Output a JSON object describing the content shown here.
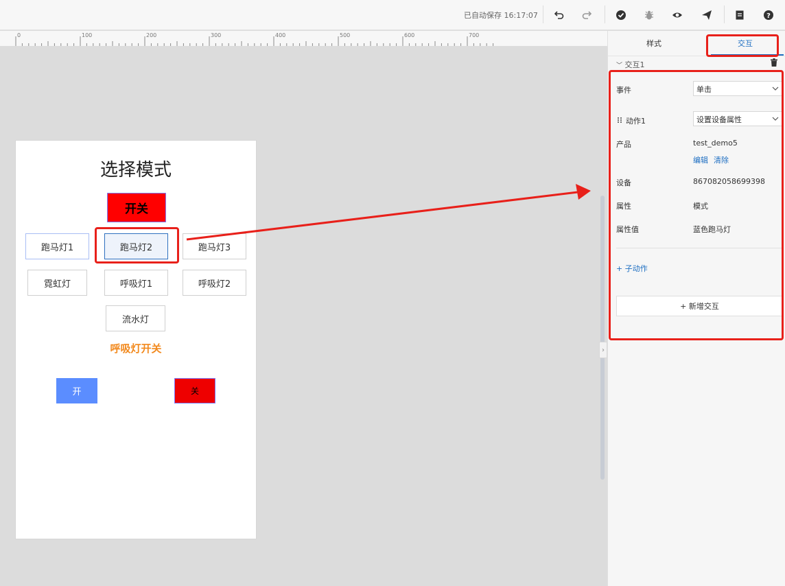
{
  "toolbar": {
    "autosave": "已自动保存 16:17:07",
    "icons": [
      "undo-icon",
      "redo-icon",
      "check-icon",
      "bug-icon",
      "eye-icon",
      "send-icon",
      "document-icon",
      "help-icon"
    ]
  },
  "ruler": {
    "ticks": [
      "0",
      "100",
      "200",
      "300",
      "400",
      "500",
      "600",
      "700"
    ]
  },
  "canvas": {
    "title": "选择模式",
    "switch_label": "开关",
    "mode_buttons": [
      "跑马灯1",
      "跑马灯2",
      "跑马灯3",
      "霓虹灯",
      "呼吸灯1",
      "呼吸灯2",
      "流水灯"
    ],
    "breath_label": "呼吸灯开关",
    "on_label": "开",
    "off_label": "关"
  },
  "panel": {
    "tabs": [
      "样式",
      "交互"
    ],
    "active_tab": "交互",
    "interaction_title": "交互1",
    "event_label": "事件",
    "event_value": "单击",
    "action_label": "动作1",
    "action_value": "设置设备属性",
    "product_label": "产品",
    "product_value": "test_demo5",
    "edit_label": "编辑",
    "clear_label": "清除",
    "device_label": "设备",
    "device_value": "867082058699398",
    "property_label": "属性",
    "property_value": "模式",
    "property_value_label": "属性值",
    "property_value_value": "蓝色跑马灯",
    "sub_action_label": "+ 子动作",
    "add_interaction_label": "+ 新增交互"
  },
  "colors": {
    "accent": "#1f6fc2",
    "highlight": "#e8201a",
    "switch_red": "#ff0000",
    "on_blue": "#5b8dff",
    "breath_orange": "#f2891d"
  }
}
